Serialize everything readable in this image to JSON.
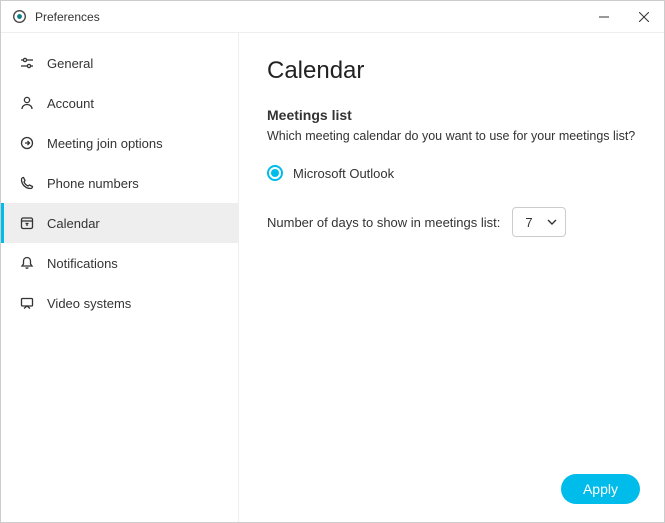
{
  "window": {
    "title": "Preferences"
  },
  "sidebar": {
    "items": [
      {
        "label": "General"
      },
      {
        "label": "Account"
      },
      {
        "label": "Meeting join options"
      },
      {
        "label": "Phone numbers"
      },
      {
        "label": "Calendar"
      },
      {
        "label": "Notifications"
      },
      {
        "label": "Video systems"
      }
    ]
  },
  "main": {
    "title": "Calendar",
    "section_title": "Meetings list",
    "section_desc": "Which meeting calendar do you want to use for your meetings list?",
    "radio_option": "Microsoft Outlook",
    "days_label": "Number of days to show in meetings list:",
    "days_value": "7"
  },
  "footer": {
    "apply": "Apply"
  }
}
